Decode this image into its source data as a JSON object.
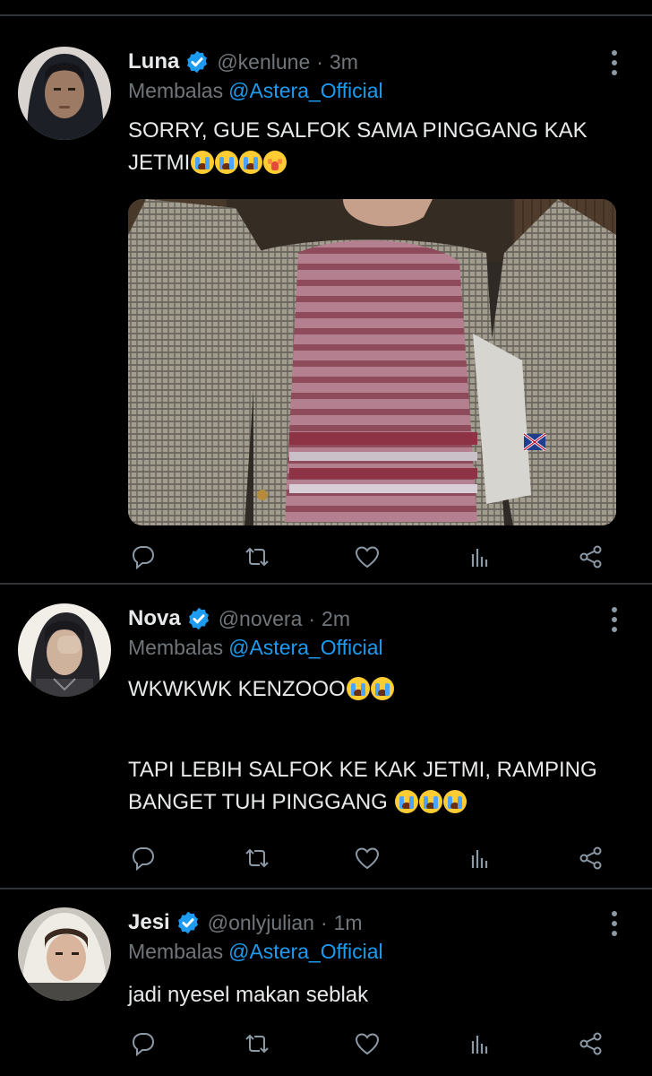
{
  "colors": {
    "background": "#000000",
    "text": "#e7e9ea",
    "muted": "#71767b",
    "accent": "#1d9bf0",
    "divider": "#2f3336",
    "verified": "#1d9bf0"
  },
  "reply_prefix": "Membalas",
  "separator": "·",
  "tweets": [
    {
      "name": "Luna",
      "handle": "@kenlune",
      "time": "3m",
      "reply_to": "@Astera_Official",
      "text_line1": "SORRY, GUE SALFOK SAMA PINGGANG KAK",
      "text_line2": "JETMI",
      "emoji_line2": [
        "loudly-crying-face",
        "loudly-crying-face",
        "loudly-crying-face",
        "hot-face"
      ],
      "has_media": true,
      "media_description_icon": "photo-person-plaid-blazer-striped-top"
    },
    {
      "name": "Nova",
      "handle": "@novera",
      "time": "2m",
      "reply_to": "@Astera_Official",
      "text_line1": "WKWKWK KENZOOO",
      "text_line3": "TAPI LEBIH SALFOK KE KAK JETMI, RAMPING",
      "text_line4": "BANGET TUH PINGGANG ",
      "emoji_line1": [
        "loudly-crying-face",
        "loudly-crying-face"
      ],
      "emoji_line4": [
        "loudly-crying-face",
        "loudly-crying-face",
        "loudly-crying-face"
      ]
    },
    {
      "name": "Jesi",
      "handle": "@onlyjulian",
      "time": "1m",
      "reply_to": "@Astera_Official",
      "text_line1": "jadi nyesel makan seblak"
    }
  ],
  "action_icons": [
    "reply-icon",
    "retweet-icon",
    "like-icon",
    "views-icon",
    "share-icon"
  ]
}
